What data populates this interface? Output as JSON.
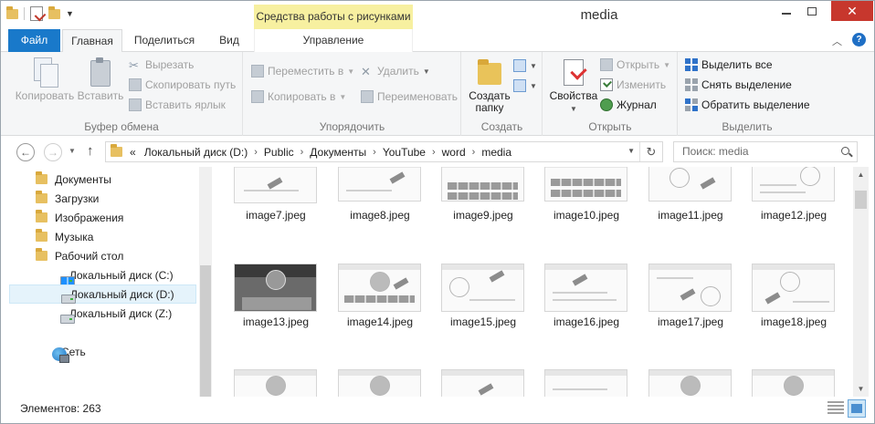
{
  "window": {
    "title": "media",
    "context_tab": "Средства работы с рисунками"
  },
  "tabs": {
    "file": "Файл",
    "home": "Главная",
    "share": "Поделиться",
    "view": "Вид",
    "manage": "Управление"
  },
  "ribbon": {
    "clipboard": {
      "label": "Буфер обмена",
      "copy": "Копировать",
      "paste": "Вставить",
      "cut": "Вырезать",
      "copy_path": "Скопировать путь",
      "paste_shortcut": "Вставить ярлык"
    },
    "organize": {
      "label": "Упорядочить",
      "move_to": "Переместить в",
      "copy_to": "Копировать в",
      "delete": "Удалить",
      "rename": "Переименовать"
    },
    "new": {
      "label": "Создать",
      "new_folder_line1": "Создать",
      "new_folder_line2": "папку"
    },
    "open": {
      "label": "Открыть",
      "properties": "Свойства",
      "open": "Открыть",
      "edit": "Изменить",
      "history": "Журнал"
    },
    "select": {
      "label": "Выделить",
      "select_all": "Выделить все",
      "select_none": "Снять выделение",
      "invert": "Обратить выделение"
    }
  },
  "address": {
    "prefix": "«",
    "crumbs": [
      "Локальный диск (D:)",
      "Public",
      "Документы",
      "YouTube",
      "word",
      "media"
    ],
    "search_placeholder": "Поиск: media"
  },
  "nav_pane": {
    "items": [
      {
        "label": "Документы",
        "icon": "folder-icon"
      },
      {
        "label": "Загрузки",
        "icon": "downloads-folder-icon"
      },
      {
        "label": "Изображения",
        "icon": "pictures-folder-icon"
      },
      {
        "label": "Музыка",
        "icon": "music-folder-icon"
      },
      {
        "label": "Рабочий стол",
        "icon": "desktop-folder-icon"
      },
      {
        "label": "Локальный диск (C:)",
        "icon": "system-drive-icon"
      },
      {
        "label": "Локальный диск (D:)",
        "icon": "drive-icon",
        "selected": true
      },
      {
        "label": "Локальный диск (Z:)",
        "icon": "drive-icon"
      },
      {
        "label": "Сеть",
        "icon": "network-icon"
      }
    ]
  },
  "files": {
    "row1": [
      "image7.jpeg",
      "image8.jpeg",
      "image9.jpeg",
      "image10.jpeg",
      "image11.jpeg",
      "image12.jpeg"
    ],
    "row2": [
      "image13.jpeg",
      "image14.jpeg",
      "image15.jpeg",
      "image16.jpeg",
      "image17.jpeg",
      "image18.jpeg"
    ]
  },
  "status": {
    "items_count": "Элементов: 263"
  }
}
